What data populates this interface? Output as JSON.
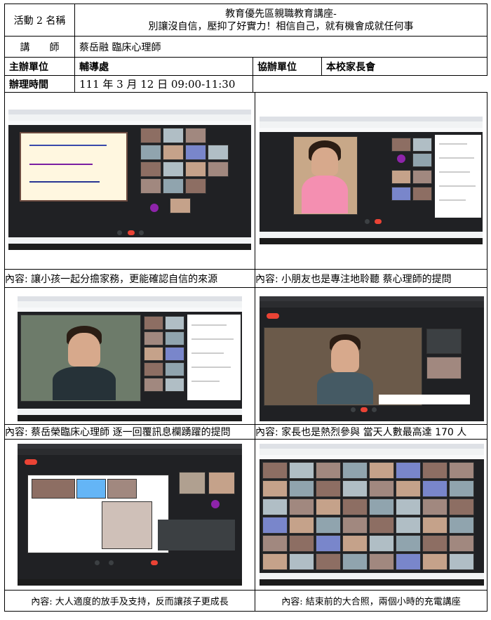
{
  "activity": {
    "name_label": "活動 2 名稱",
    "title_line1": "教育優先區親職教育講座-",
    "title_line2": "別讓沒自信，壓抑了好實力！相信自己，就有機會成就任何事",
    "speaker_label": "講　　師",
    "speaker": "蔡岳融 臨床心理師",
    "organizer_label": "主辦單位",
    "organizer": "輔導處",
    "co_organizer_label": "協辦單位",
    "co_organizer": "本校家長會",
    "time_label": "辦理時間",
    "time": "111 年 3 月 12 日  09:00-11:30"
  },
  "photos": [
    {
      "caption": "內容: 讓小孩一起分擔家務，更能確認自信的來源",
      "icon": "meet-screenshot-icon"
    },
    {
      "caption": "內容: 小朋友也是專注地聆聽  蔡心理師的提問",
      "icon": "meet-screenshot-icon"
    },
    {
      "caption": "內容: 蔡岳榮臨床心理師  逐一回覆訊息欄踴躍的提問",
      "icon": "meet-screenshot-icon"
    },
    {
      "caption": "內容: 家長也是熱烈參與  當天人數最高達 170 人",
      "icon": "meet-screenshot-icon"
    },
    {
      "caption": "內容:  大人適度的放手及支持，反而讓孩子更成長",
      "icon": "meet-screenshot-icon"
    },
    {
      "caption": "內容:  結束前的大合照，兩個小時的充電講座",
      "icon": "meet-screenshot-icon"
    }
  ],
  "colors": {
    "meet_bg": "#202124",
    "end_call": "#ea4335",
    "avatar": "#8e24aa"
  }
}
